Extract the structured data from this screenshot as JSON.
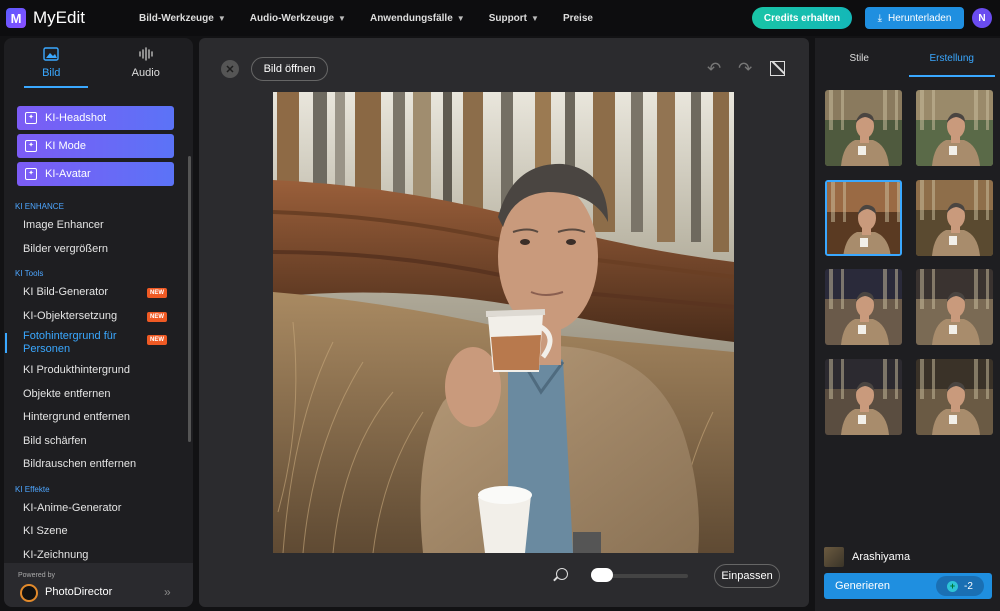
{
  "app": {
    "logo_letter": "M",
    "name": "MyEdit"
  },
  "nav": [
    {
      "label": "Bild-Werkzeuge",
      "has_menu": true
    },
    {
      "label": "Audio-Werkzeuge",
      "has_menu": true
    },
    {
      "label": "Anwendungsfälle",
      "has_menu": true
    },
    {
      "label": "Support",
      "has_menu": true
    },
    {
      "label": "Preise",
      "has_menu": false
    }
  ],
  "header": {
    "credits_label": "Credits erhalten",
    "download_label": "Herunterladen",
    "user_initial": "N"
  },
  "sidebar": {
    "tabs": [
      {
        "label": "Bild",
        "active": true
      },
      {
        "label": "Audio",
        "active": false
      }
    ],
    "ai_buttons": [
      "KI-Headshot",
      "KI Mode",
      "KI-Avatar"
    ],
    "sections": [
      {
        "title": "KI ENHANCE",
        "items": [
          {
            "label": "Image Enhancer"
          },
          {
            "label": "Bilder vergrößern"
          }
        ]
      },
      {
        "title": "KI Tools",
        "items": [
          {
            "label": "KI Bild-Generator",
            "badge": "NEW"
          },
          {
            "label": "KI-Objektersetzung",
            "badge": "NEW"
          },
          {
            "label": "Fotohintergrund für Personen",
            "badge": "NEW",
            "active": true
          },
          {
            "label": "KI Produkthintergrund"
          },
          {
            "label": "Objekte entfernen"
          },
          {
            "label": "Hintergrund entfernen"
          },
          {
            "label": "Bild schärfen"
          },
          {
            "label": "Bildrauschen entfernen"
          }
        ]
      },
      {
        "title": "KI Effekte",
        "items": [
          {
            "label": "KI-Anime-Generator"
          },
          {
            "label": "KI Szene"
          },
          {
            "label": "KI-Zeichnung"
          }
        ]
      }
    ],
    "footer": {
      "powered_by": "Powered by",
      "product": "PhotoDirector"
    }
  },
  "canvas": {
    "open_label": "Bild öffnen",
    "fit_label": "Einpassen",
    "zoom_level": 0.05
  },
  "right_panel": {
    "tabs": [
      {
        "label": "Stile",
        "active": false
      },
      {
        "label": "Erstellung",
        "active": true
      }
    ],
    "selected_thumbnail": 3,
    "style_name": "Arashiyama",
    "generate_label": "Generieren",
    "credit_cost": "-2"
  },
  "colors": {
    "accent": "#3aa8ff",
    "primary_button": "#1f8fe0",
    "credits_button": "#19c4a6",
    "new_badge": "#ef5a24",
    "ai_button": "#7c5cf5"
  }
}
